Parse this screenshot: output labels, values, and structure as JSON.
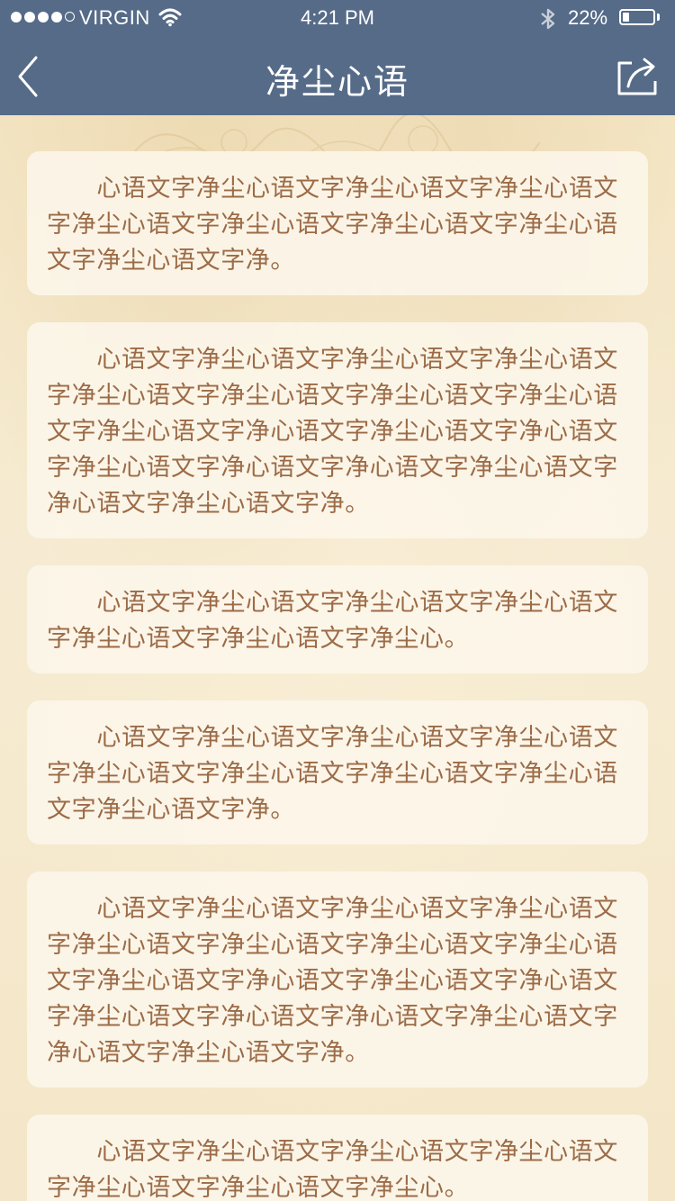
{
  "status_bar": {
    "carrier": "VIRGIN",
    "time": "4:21 PM",
    "battery": "22%",
    "battery_level": 0.22
  },
  "nav": {
    "title": "净尘心语",
    "back_icon": "chevron-left-icon",
    "share_icon": "share-icon"
  },
  "colors": {
    "nav_bg": "#566b88",
    "text": "#9c6b47",
    "card_bg": "#fcf6ea",
    "page_bg": "#f5e9cc"
  },
  "cards": [
    {
      "text": "心语文字净尘心语文字净尘心语文字净尘心语文字净尘心语文字净尘心语文字净尘心语文字净尘心语文字净尘心语文字净。"
    },
    {
      "text": "心语文字净尘心语文字净尘心语文字净尘心语文字净尘心语文字净尘心语文字净尘心语文字净尘心语文字净尘心语文字净心语文字净尘心语文字净心语文字净尘心语文字净心语文字净心语文字净尘心语文字净心语文字净尘心语文字净。"
    },
    {
      "text": "心语文字净尘心语文字净尘心语文字净尘心语文字净尘心语文字净尘心语文字净尘心。"
    },
    {
      "text": "心语文字净尘心语文字净尘心语文字净尘心语文字净尘心语文字净尘心语文字净尘心语文字净尘心语文字净尘心语文字净。"
    },
    {
      "text": "心语文字净尘心语文字净尘心语文字净尘心语文字净尘心语文字净尘心语文字净尘心语文字净尘心语文字净尘心语文字净心语文字净尘心语文字净心语文字净尘心语文字净心语文字净心语文字净尘心语文字净心语文字净尘心语文字净。"
    },
    {
      "text": "心语文字净尘心语文字净尘心语文字净尘心语文字净尘心语文字净尘心语文字净尘心。"
    }
  ]
}
